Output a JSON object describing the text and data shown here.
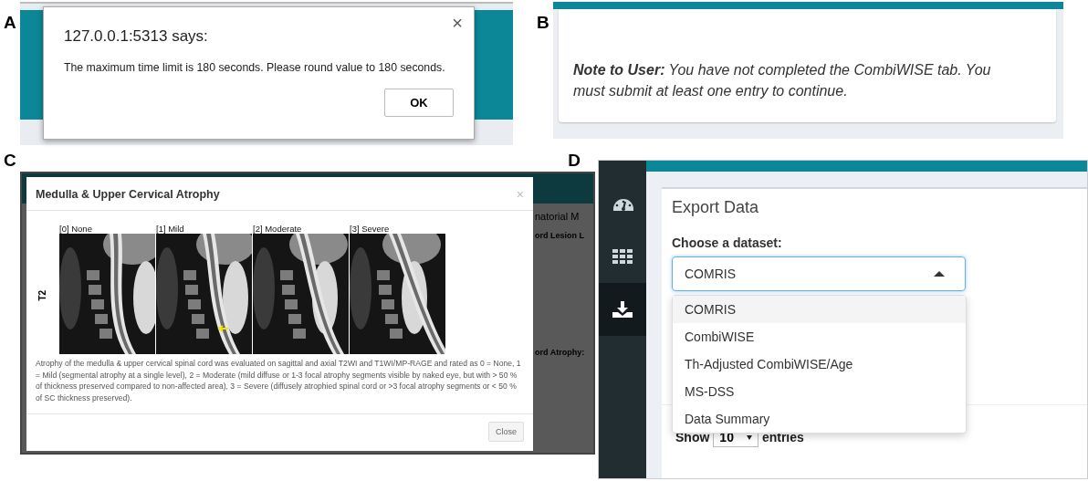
{
  "panel_a": {
    "label": "A",
    "dialog": {
      "title": "127.0.0.1:5313 says:",
      "close": "×",
      "message": "The maximum time limit is 180 seconds. Please round value to 180 seconds.",
      "button": "OK"
    }
  },
  "panel_b": {
    "label": "B",
    "note": "**Note to User:** You have not completed the CombiWISE tab. You must submit at least one entry to continue."
  },
  "panel_c": {
    "label": "C",
    "background_fragments": [
      "natorial M",
      "ord Lesion L",
      "ord Atrophy:"
    ],
    "modal": {
      "title": "Medulla & Upper Cervical Atrophy",
      "close": "×",
      "row_label": "T2",
      "images": [
        {
          "caption": "[0] None",
          "marked": false
        },
        {
          "caption": "[1] Mild",
          "marked": true
        },
        {
          "caption": "[2] Moderate",
          "marked": false
        },
        {
          "caption": "[3] Severe",
          "marked": false
        }
      ],
      "description": "Atrophy of the medulla & upper cervical spinal cord was evaluated on sagittal and axial T2WI and T1WI/MP-RAGE and rated as 0 = None, 1 = Mild (segmental atrophy at a single level), 2 = Moderate (mild diffuse or 1-3 focal atrophy segments visible by naked eye, but with > 50 % of thickness preserved compared to non-affected area), 3 = Severe (diffusely atrophied spinal cord or >3 focal atrophy segments or < 50 % of SC thickness preserved).",
      "button": "Close"
    }
  },
  "panel_d": {
    "label": "D",
    "sidebar": [
      {
        "kind": "gauge",
        "selected": false
      },
      {
        "kind": "grid",
        "selected": false
      },
      {
        "kind": "download",
        "selected": true
      }
    ],
    "heading": "Export Data",
    "field_label": "Choose a dataset:",
    "select": {
      "value": "COMRIS",
      "expanded": true
    },
    "options": [
      {
        "label": "COMRIS",
        "selected": true
      },
      {
        "label": "CombiWISE",
        "selected": false
      },
      {
        "label": "Th-Adjusted CombiWISE/Age",
        "selected": false
      },
      {
        "label": "MS-DSS",
        "selected": false
      },
      {
        "label": "Data Summary",
        "selected": false
      }
    ],
    "length": {
      "prefix": "Show",
      "value": "10",
      "suffix": "entries"
    }
  }
}
